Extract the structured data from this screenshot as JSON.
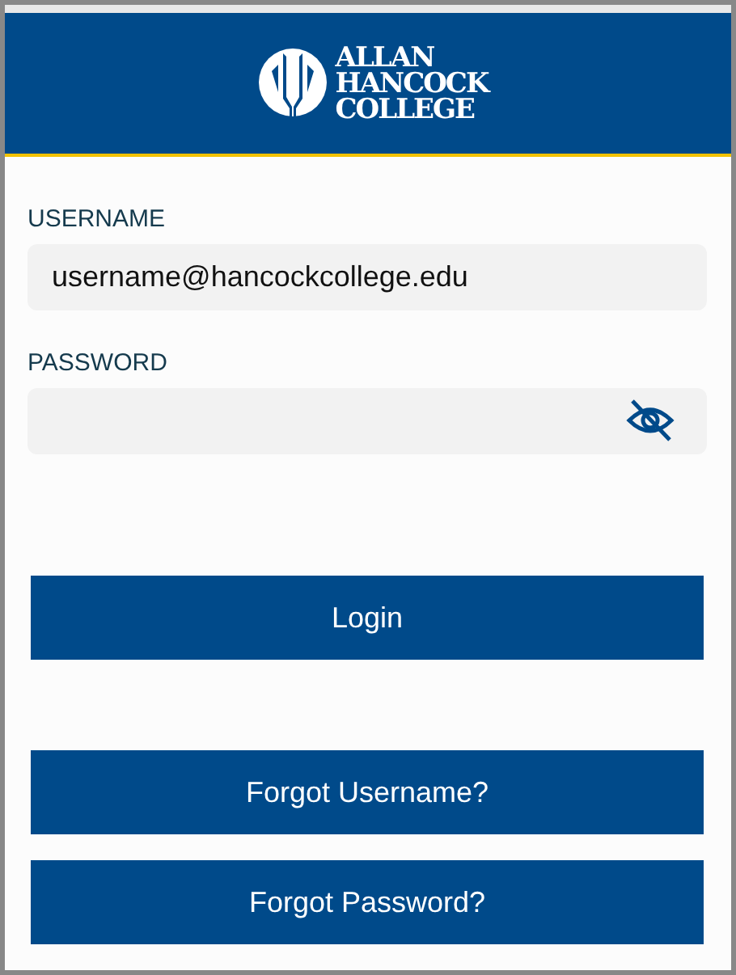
{
  "logo": {
    "lines": [
      "ALLAN",
      "HANCOCK",
      "COLLEGE"
    ]
  },
  "fields": [
    {
      "label": "USERNAME",
      "value": "username@hancockcollege.edu",
      "kind": "text"
    },
    {
      "label": "PASSWORD",
      "kind": "password"
    }
  ],
  "login_button": "Login",
  "help_buttons": [
    "Forgot Username?",
    "Forgot Password?"
  ]
}
